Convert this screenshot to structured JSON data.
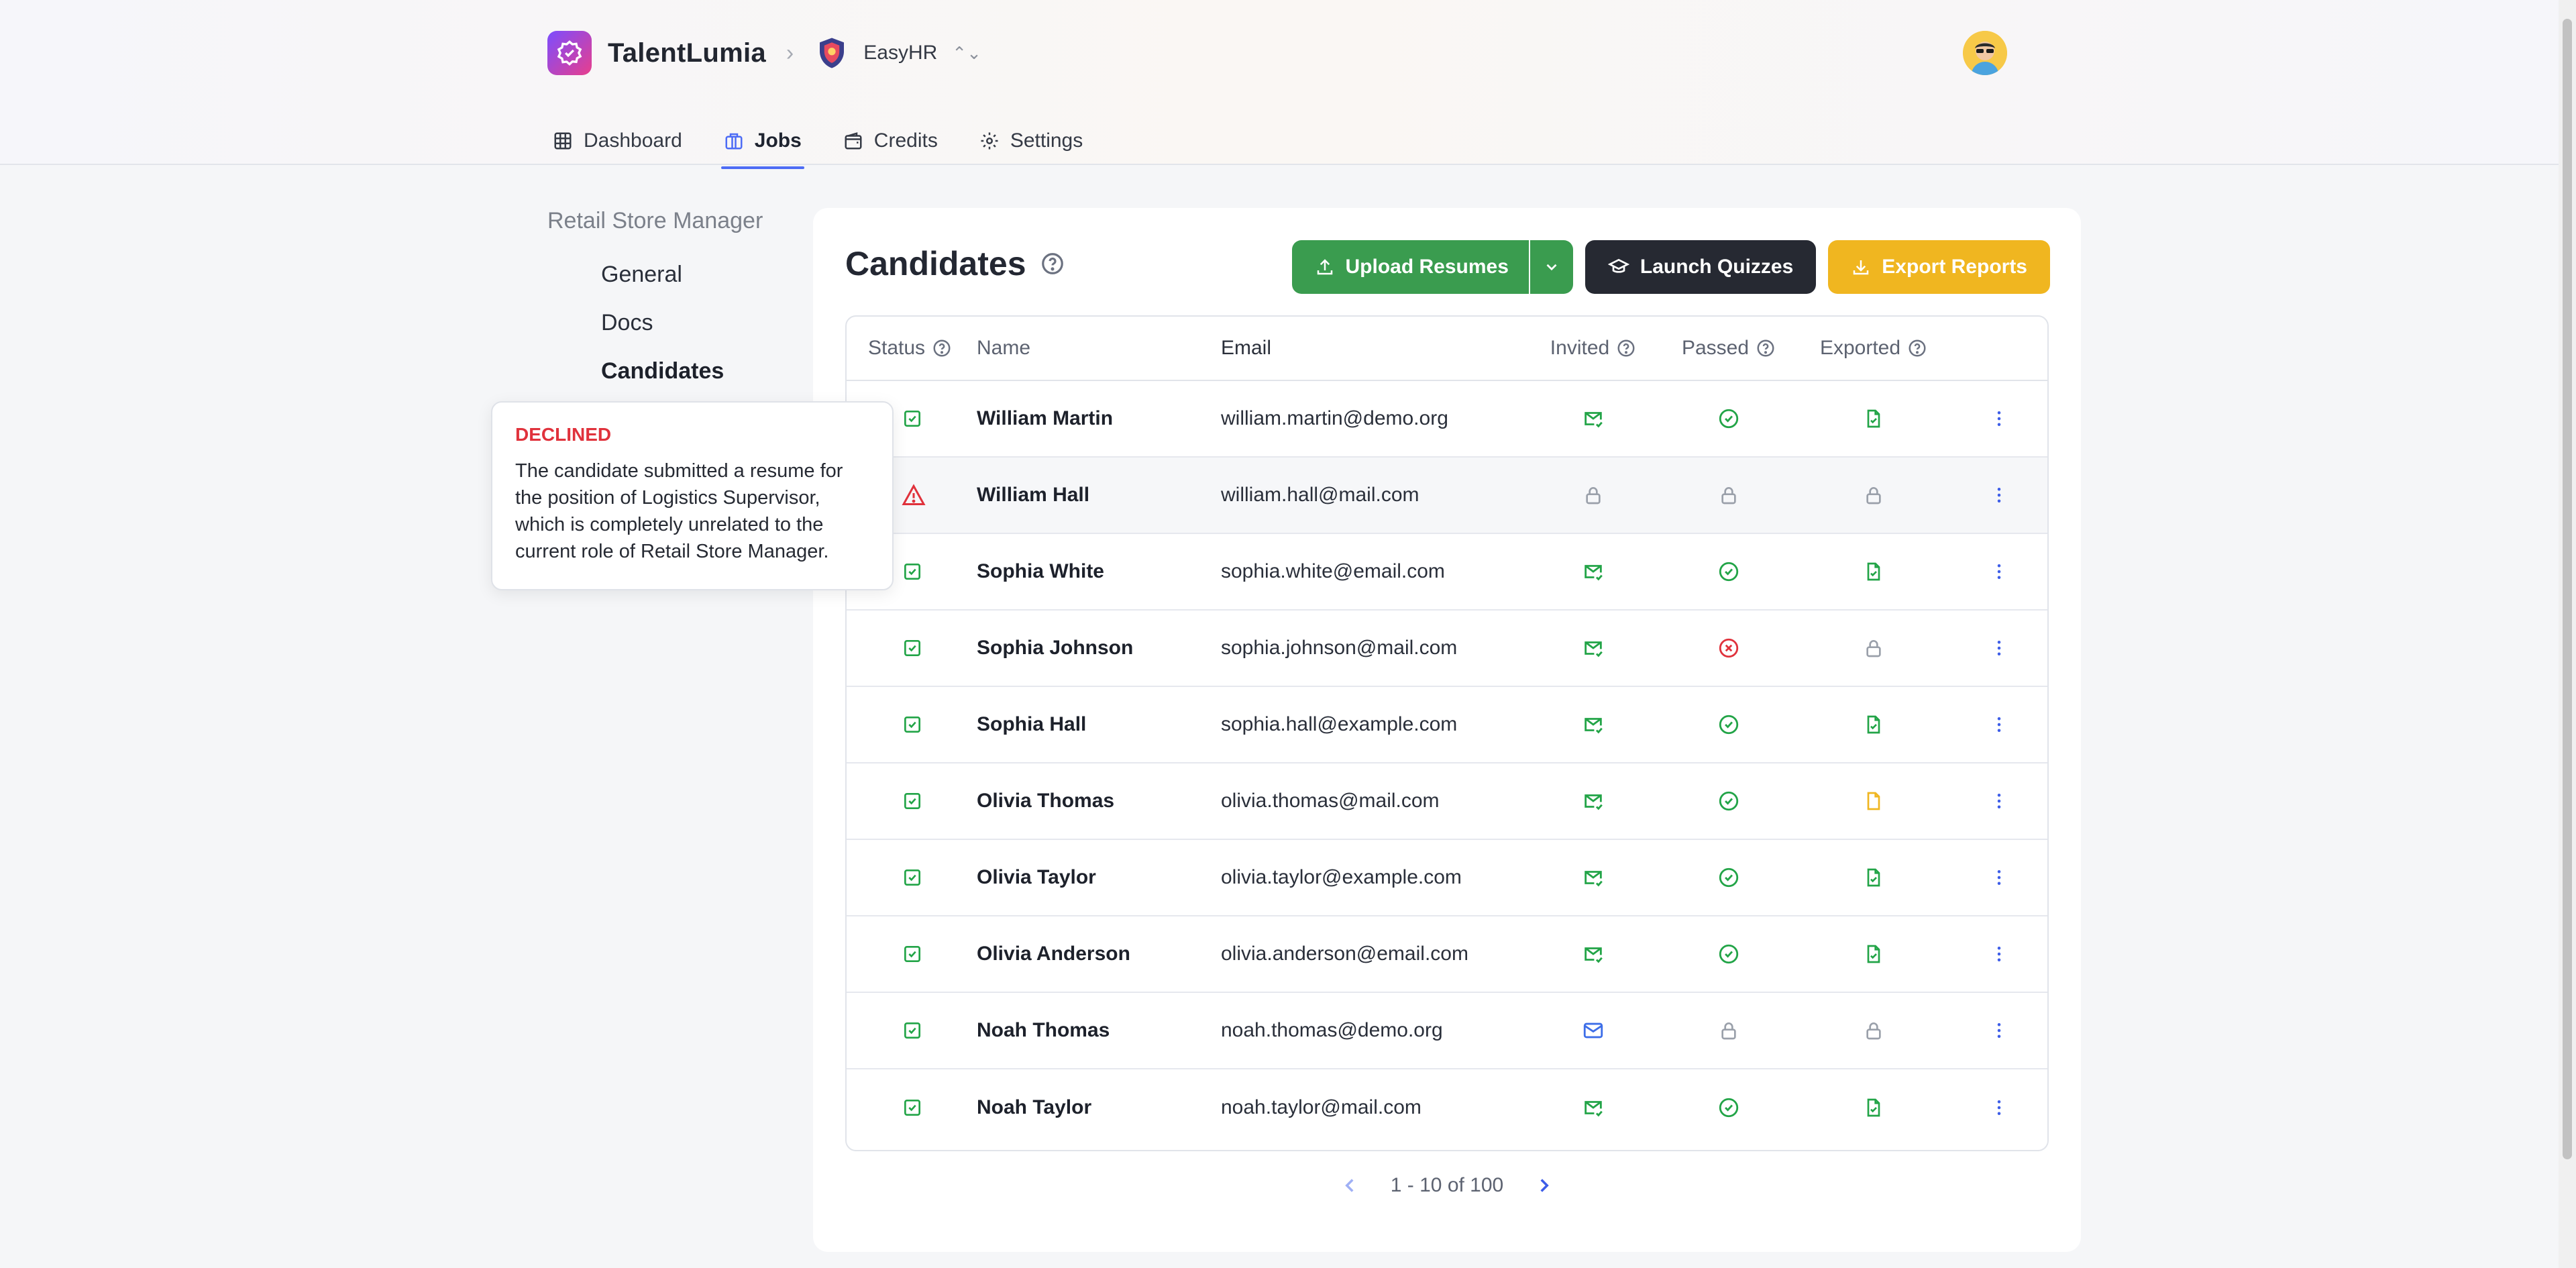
{
  "header": {
    "brand": "TalentLumia",
    "org": "EasyHR",
    "nav": [
      {
        "label": "Dashboard",
        "icon": "grid-icon"
      },
      {
        "label": "Jobs",
        "icon": "briefcase-icon",
        "active": true
      },
      {
        "label": "Credits",
        "icon": "wallet-icon"
      },
      {
        "label": "Settings",
        "icon": "gear-icon"
      }
    ]
  },
  "sidebar": {
    "job_title": "Retail Store Manager",
    "items": [
      {
        "label": "General"
      },
      {
        "label": "Docs"
      },
      {
        "label": "Candidates",
        "active": true
      }
    ]
  },
  "tooltip": {
    "title": "DECLINED",
    "body": "The candidate submitted a resume for the position of Logistics Supervisor, which is completely unrelated to the current role of Retail Store Manager."
  },
  "main": {
    "title": "Candidates",
    "actions": {
      "upload": "Upload Resumes",
      "quiz": "Launch Quizzes",
      "export": "Export Reports"
    },
    "columns": {
      "status": "Status",
      "name": "Name",
      "email": "Email",
      "invited": "Invited",
      "passed": "Passed",
      "exported": "Exported"
    },
    "rows": [
      {
        "name": "William Martin",
        "email": "william.martin@demo.org",
        "status": "ok",
        "invited": "sent",
        "passed": "passed",
        "exported": "done"
      },
      {
        "name": "William Hall",
        "email": "william.hall@mail.com",
        "status": "declined",
        "invited": "locked",
        "passed": "locked",
        "exported": "locked"
      },
      {
        "name": "Sophia White",
        "email": "sophia.white@email.com",
        "status": "ok",
        "invited": "sent",
        "passed": "passed",
        "exported": "done"
      },
      {
        "name": "Sophia Johnson",
        "email": "sophia.johnson@mail.com",
        "status": "ok",
        "invited": "sent",
        "passed": "failed",
        "exported": "locked"
      },
      {
        "name": "Sophia Hall",
        "email": "sophia.hall@example.com",
        "status": "ok",
        "invited": "sent",
        "passed": "passed",
        "exported": "done"
      },
      {
        "name": "Olivia Thomas",
        "email": "olivia.thomas@mail.com",
        "status": "ok",
        "invited": "sent",
        "passed": "passed",
        "exported": "pending"
      },
      {
        "name": "Olivia Taylor",
        "email": "olivia.taylor@example.com",
        "status": "ok",
        "invited": "sent",
        "passed": "passed",
        "exported": "done"
      },
      {
        "name": "Olivia Anderson",
        "email": "olivia.anderson@email.com",
        "status": "ok",
        "invited": "sent",
        "passed": "passed",
        "exported": "done"
      },
      {
        "name": "Noah Thomas",
        "email": "noah.thomas@demo.org",
        "status": "ok",
        "invited": "unread",
        "passed": "locked",
        "exported": "locked"
      },
      {
        "name": "Noah Taylor",
        "email": "noah.taylor@mail.com",
        "status": "ok",
        "invited": "sent",
        "passed": "passed",
        "exported": "done"
      }
    ],
    "pagination": "1 - 10 of 100"
  },
  "colors": {
    "accent": "#4d6cf5",
    "success": "#22a447",
    "danger": "#e0323c",
    "warning": "#f0b620",
    "muted": "#9aa0aa"
  }
}
